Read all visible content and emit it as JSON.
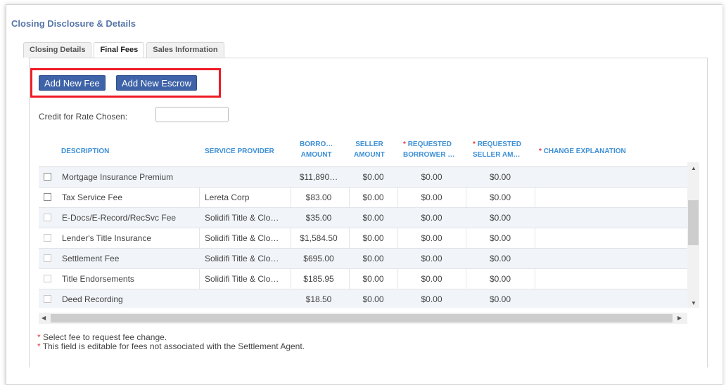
{
  "panel": {
    "title": "Closing Disclosure & Details"
  },
  "tabs": [
    {
      "label": "Closing Details",
      "active": false
    },
    {
      "label": "Final Fees",
      "active": true
    },
    {
      "label": "Sales Information",
      "active": false
    }
  ],
  "actions": {
    "add_fee": "Add New Fee",
    "add_escrow": "Add New Escrow"
  },
  "credit": {
    "label": "Credit for Rate Chosen:",
    "value": ""
  },
  "table": {
    "headers": {
      "description": "DESCRIPTION",
      "service_provider": "SERVICE PROVIDER",
      "borrower_amount_1": "BORRO…",
      "borrower_amount_2": "AMOUNT",
      "seller_amount_1": "SELLER",
      "seller_amount_2": "AMOUNT",
      "req_borrower_1": "REQUESTED",
      "req_borrower_2": "BORROWER …",
      "req_seller_1": "REQUESTED",
      "req_seller_2": "SELLER AM…",
      "change_explanation": "CHANGE EXPLANATION",
      "required_mark": "*"
    },
    "rows": [
      {
        "description": "Mortgage Insurance Premium",
        "provider": "",
        "borrower": "$11,890…",
        "seller": "$0.00",
        "req_borrower": "$0.00",
        "req_seller": "$0.00",
        "explanation": "",
        "enabled": true
      },
      {
        "description": "Tax Service Fee",
        "provider": "Lereta Corp",
        "borrower": "$83.00",
        "seller": "$0.00",
        "req_borrower": "$0.00",
        "req_seller": "$0.00",
        "explanation": "",
        "enabled": true
      },
      {
        "description": "E-Docs/E-Record/RecSvc Fee",
        "provider": "Solidifi Title & Clo…",
        "borrower": "$35.00",
        "seller": "$0.00",
        "req_borrower": "$0.00",
        "req_seller": "$0.00",
        "explanation": "",
        "enabled": false
      },
      {
        "description": "Lender's Title Insurance",
        "provider": "Solidifi Title & Clo…",
        "borrower": "$1,584.50",
        "seller": "$0.00",
        "req_borrower": "$0.00",
        "req_seller": "$0.00",
        "explanation": "",
        "enabled": false
      },
      {
        "description": "Settlement Fee",
        "provider": "Solidifi Title & Clo…",
        "borrower": "$695.00",
        "seller": "$0.00",
        "req_borrower": "$0.00",
        "req_seller": "$0.00",
        "explanation": "",
        "enabled": false
      },
      {
        "description": "Title Endorsements",
        "provider": "Solidifi Title & Clo…",
        "borrower": "$185.95",
        "seller": "$0.00",
        "req_borrower": "$0.00",
        "req_seller": "$0.00",
        "explanation": "",
        "enabled": false
      },
      {
        "description": "Deed Recording",
        "provider": "",
        "borrower": "$18.50",
        "seller": "$0.00",
        "req_borrower": "$0.00",
        "req_seller": "$0.00",
        "explanation": "",
        "enabled": false
      }
    ]
  },
  "notes": {
    "line1": "Select fee to request fee change.",
    "line2": "This field is editable for fees not associated with the Settlement Agent.",
    "mark": "*"
  },
  "colors": {
    "accent": "#3e63a8",
    "header_text": "#3d8fd6",
    "required": "#e23c3c",
    "highlight": "#ee1c25"
  },
  "icons": {
    "scroll_up": "triangle-up",
    "scroll_down": "triangle-down",
    "scroll_left": "triangle-left",
    "scroll_right": "triangle-right"
  }
}
